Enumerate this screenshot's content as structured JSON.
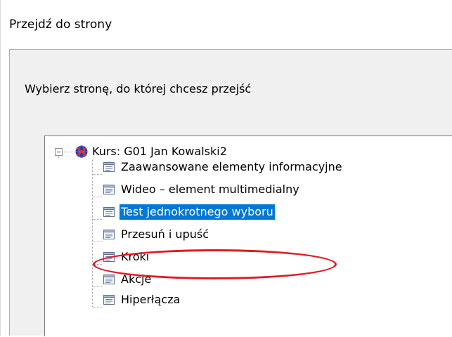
{
  "dialog": {
    "title": "Przejdź do strony",
    "prompt": "Wybierz stronę, do której chcesz przejść"
  },
  "tree": {
    "root": {
      "label": "Kurs: G01 Jan Kowalski2",
      "icon": "course-globe-icon",
      "expanded": true
    },
    "children": [
      {
        "label": "Zaawansowane elementy informacyjne",
        "icon": "page-icon",
        "selected": false
      },
      {
        "label": "Wideo – element multimedialny",
        "icon": "page-icon",
        "selected": false
      },
      {
        "label": "Test jednokrotnego wyboru",
        "icon": "page-icon",
        "selected": true
      },
      {
        "label": "Przesuń i upuść",
        "icon": "page-icon",
        "selected": false
      },
      {
        "label": "Kroki",
        "icon": "page-icon",
        "selected": false
      },
      {
        "label": "Akcje",
        "icon": "page-icon",
        "selected": false
      },
      {
        "label": "Hiperłącza",
        "icon": "page-icon",
        "selected": false
      }
    ]
  },
  "colors": {
    "selection": "#0078d7",
    "annotation": "#e01a24",
    "panel_background": "#f0f0f0"
  }
}
